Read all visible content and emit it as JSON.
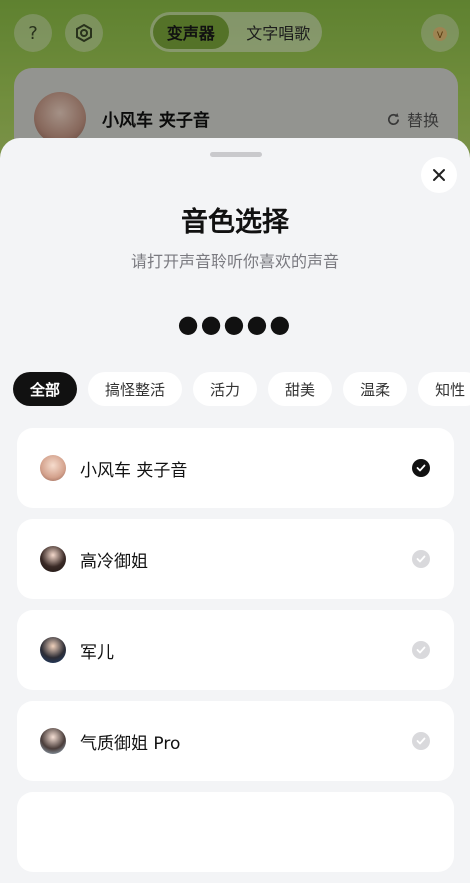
{
  "header": {
    "help_icon": "question-icon",
    "settings_icon": "hexagon-gear-icon",
    "tabs": [
      {
        "label": "变声器",
        "active": true
      },
      {
        "label": "文字唱歌",
        "active": false
      }
    ]
  },
  "current_voice": {
    "name": "小风车 夹子音",
    "replace_label": "替换"
  },
  "sheet": {
    "title": "音色选择",
    "subtitle": "请打开声音聆听你喜欢的声音",
    "indicator": "●●●●●",
    "categories": [
      {
        "label": "全部",
        "active": true
      },
      {
        "label": "搞怪整活"
      },
      {
        "label": "活力"
      },
      {
        "label": "甜美"
      },
      {
        "label": "温柔"
      },
      {
        "label": "知性"
      }
    ],
    "voices": [
      {
        "name": "小风车 夹子音",
        "selected": true
      },
      {
        "name": "高冷御姐",
        "selected": false
      },
      {
        "name": "军儿",
        "selected": false
      },
      {
        "name": "气质御姐 Pro",
        "selected": false
      }
    ]
  },
  "colors": {
    "accent": "#7da93c",
    "selected_check": "#111111",
    "unselected_check": "#d9d9dc"
  }
}
